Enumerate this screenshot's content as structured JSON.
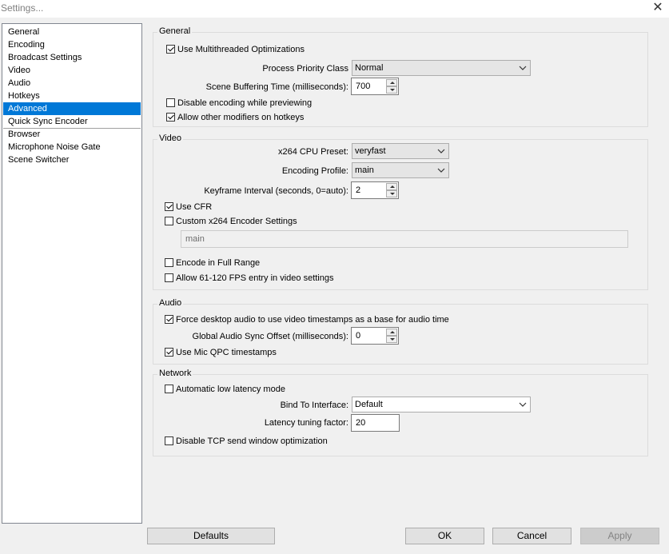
{
  "window": {
    "title": "Settings...",
    "close_glyph": "✕"
  },
  "sidebar": {
    "items": [
      {
        "label": "General"
      },
      {
        "label": "Encoding"
      },
      {
        "label": "Broadcast Settings"
      },
      {
        "label": "Video"
      },
      {
        "label": "Audio"
      },
      {
        "label": "Hotkeys"
      },
      {
        "label": "Advanced",
        "selected": true
      },
      {
        "label": "Quick Sync Encoder"
      },
      {
        "label": "Browser"
      },
      {
        "label": "Microphone Noise Gate"
      },
      {
        "label": "Scene Switcher"
      }
    ]
  },
  "general": {
    "title": "General",
    "multithreaded": {
      "label": "Use Multithreaded Optimizations",
      "checked": true
    },
    "priority_label": "Process Priority Class",
    "priority_value": "Normal",
    "buffering_label": "Scene Buffering Time (milliseconds):",
    "buffering_value": "700",
    "disable_preview": {
      "label": "Disable encoding while previewing",
      "checked": false
    },
    "allow_modifiers": {
      "label": "Allow other modifiers on hotkeys",
      "checked": true
    }
  },
  "video": {
    "title": "Video",
    "preset_label": "x264 CPU Preset:",
    "preset_value": "veryfast",
    "profile_label": "Encoding Profile:",
    "profile_value": "main",
    "keyframe_label": "Keyframe Interval (seconds, 0=auto):",
    "keyframe_value": "2",
    "use_cfr": {
      "label": "Use CFR",
      "checked": true
    },
    "custom_x264": {
      "label": "Custom x264 Encoder Settings",
      "checked": false
    },
    "custom_x264_value": "main",
    "full_range": {
      "label": "Encode in Full Range",
      "checked": false
    },
    "allow_high_fps": {
      "label": "Allow 61-120 FPS entry in video settings",
      "checked": false
    }
  },
  "audio": {
    "title": "Audio",
    "force_desktop": {
      "label": "Force desktop audio to use video timestamps as a base for audio time",
      "checked": true
    },
    "sync_offset_label": "Global Audio Sync Offset (milliseconds):",
    "sync_offset_value": "0",
    "mic_qpc": {
      "label": "Use Mic QPC timestamps",
      "checked": true
    }
  },
  "network": {
    "title": "Network",
    "low_latency": {
      "label": "Automatic low latency mode",
      "checked": false
    },
    "bind_label": "Bind To Interface:",
    "bind_value": "Default",
    "latency_label": "Latency tuning factor:",
    "latency_value": "20",
    "disable_tcp": {
      "label": "Disable TCP send window optimization",
      "checked": false
    }
  },
  "buttons": {
    "defaults": "Defaults",
    "ok": "OK",
    "cancel": "Cancel",
    "apply": "Apply"
  }
}
